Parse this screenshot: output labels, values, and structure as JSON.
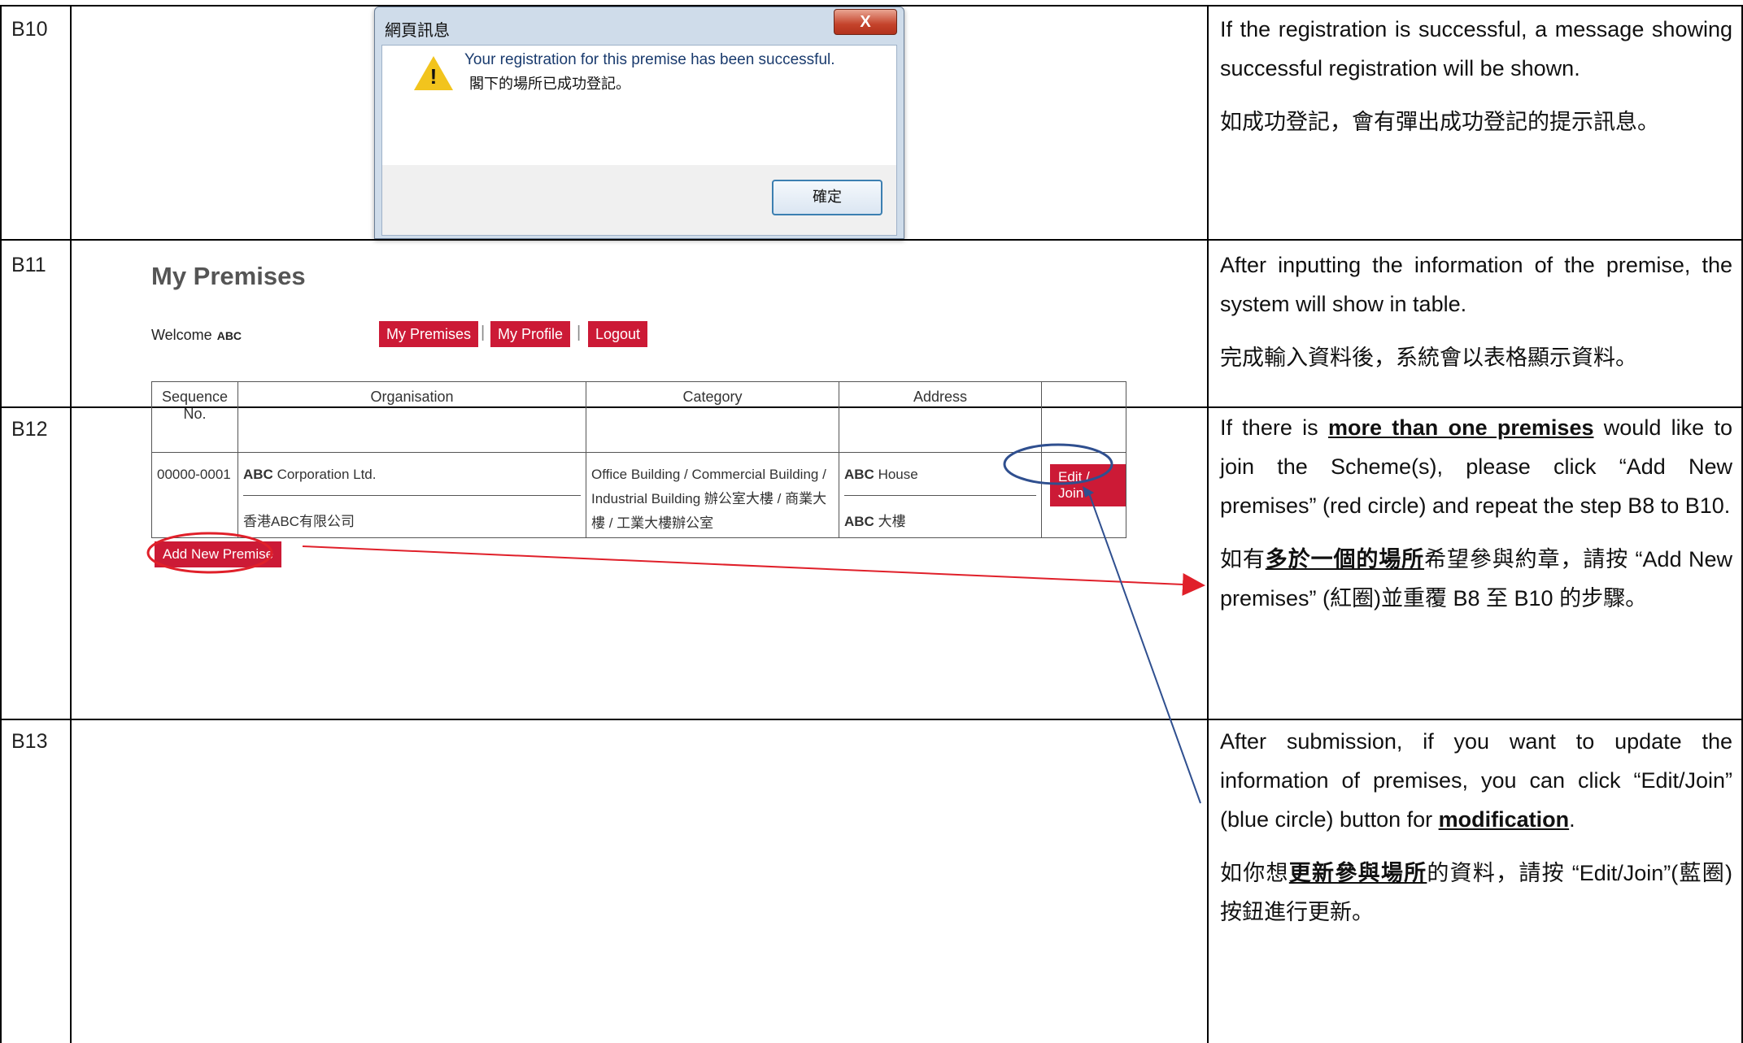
{
  "rows": [
    {
      "id": "B10"
    },
    {
      "id": "B11"
    },
    {
      "id": "B12"
    },
    {
      "id": "B13"
    }
  ],
  "dialog": {
    "title": "網頁訊息",
    "close": "X",
    "message_en": "Your registration for this premise has been successful.",
    "message_zh": "閣下的場所已成功登記。",
    "ok": "確定"
  },
  "premises": {
    "title": "My Premises",
    "welcome": "Welcome",
    "user": "ABC",
    "nav": [
      "My Premises",
      "My Profile",
      "Logout"
    ],
    "separator": "|",
    "columns": [
      "Sequence No.",
      "Organisation",
      "Category",
      "Address",
      ""
    ],
    "row": {
      "seq": "00000-0001",
      "org_en_bold": "ABC",
      "org_en_rest": " Corporation Ltd.",
      "org_zh": "香港ABC有限公司",
      "category": "Office Building / Commercial Building / Industrial Building 辦公室大樓 / 商業大樓 / 工業大樓辦公室",
      "addr_en_bold": "ABC",
      "addr_en_rest": " House",
      "addr_zh_bold": "ABC",
      "addr_zh_rest": " 大樓",
      "action": "Edit / Join"
    },
    "add_button": "Add New Premise"
  },
  "descriptions": {
    "b10_en": "If the registration is successful, a message showing successful registration will be shown.",
    "b10_zh": "如成功登記，會有彈出成功登記的提示訊息。",
    "b11_en": "After inputting the information of the premise, the system will show in table.",
    "b11_zh": "完成輸入資料後，系統會以表格顯示資料。",
    "b12_en_pre": "If there is ",
    "b12_en_bold": "more than one premises",
    "b12_en_post": " would like to join the Scheme(s), please click “Add New premises” (red circle) and repeat the step B8 to B10.",
    "b12_zh_pre": "如有",
    "b12_zh_bold": "多於一個的場所",
    "b12_zh_post": "希望參與約章，請按 “Add New premises” (紅圈)並重覆 B8 至 B10 的步驟。",
    "b13_en_pre": "After submission, if you want to update the information of premises, you can click “Edit/Join” (blue circle) button for ",
    "b13_en_bold": "modification",
    "b13_en_post": ".",
    "b13_zh_pre": "如你想",
    "b13_zh_bold": "更新參與場所",
    "b13_zh_post": "的資料，請按 “Edit/Join”(藍圈)按鈕進行更新。"
  },
  "annotations": {
    "red_color": "#e0202a",
    "blue_color": "#2f4f8f"
  }
}
